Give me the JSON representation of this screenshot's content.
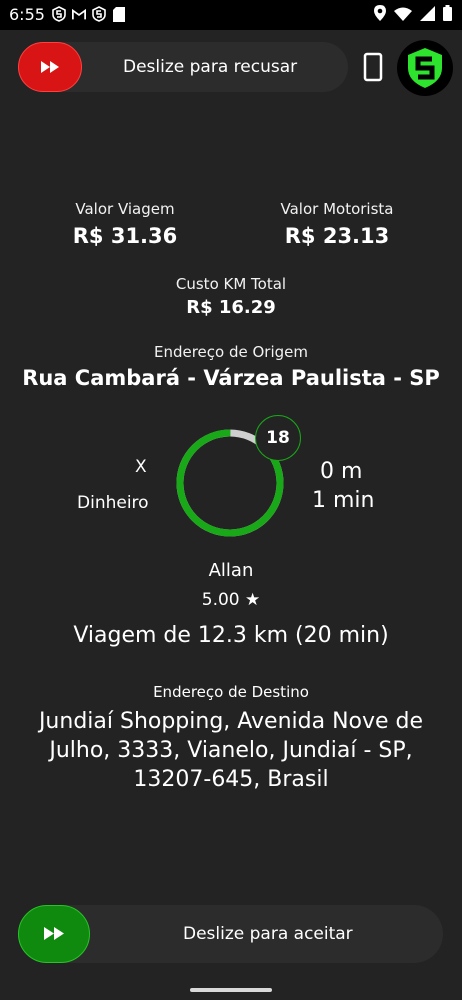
{
  "statusbar": {
    "time": "6:55",
    "left_icons": [
      "s-app-icon",
      "gmail-icon",
      "s-app-icon",
      "sd-card-icon"
    ],
    "right_icons": [
      "location-icon",
      "wifi-icon",
      "signal-icon",
      "battery-icon"
    ]
  },
  "top_slider": {
    "label": "Deslize para recusar"
  },
  "trip_values": {
    "valor_viagem_label": "Valor Viagem",
    "valor_viagem": "R$ 31.36",
    "valor_motorista_label": "Valor Motorista",
    "valor_motorista": "R$ 23.13",
    "custo_km_label": "Custo KM Total",
    "custo_km": "R$ 16.29"
  },
  "origin": {
    "label": "Endereço de Origem",
    "address": "Rua Cambará - Várzea Paulista - SP"
  },
  "countdown": {
    "value": "18",
    "progress": 0.85
  },
  "info": {
    "x": "X",
    "payment": "Dinheiro",
    "distance": "0 m",
    "time": "1 min"
  },
  "driver": {
    "name": "Allan",
    "rating": "5.00 ★"
  },
  "trip_summary": "Viagem de 12.3 km (20 min)",
  "destination": {
    "label": "Endereço de Destino",
    "address": "Jundiaí Shopping, Avenida Nove de Julho, 3333, Vianelo, Jundiaí - SP, 13207-645, Brasil"
  },
  "bottom_slider": {
    "label": "Deslize para aceitar"
  },
  "colors": {
    "accept": "#0f8a0f",
    "reject": "#d91414",
    "ring": "#18a818",
    "bg": "#232323"
  }
}
